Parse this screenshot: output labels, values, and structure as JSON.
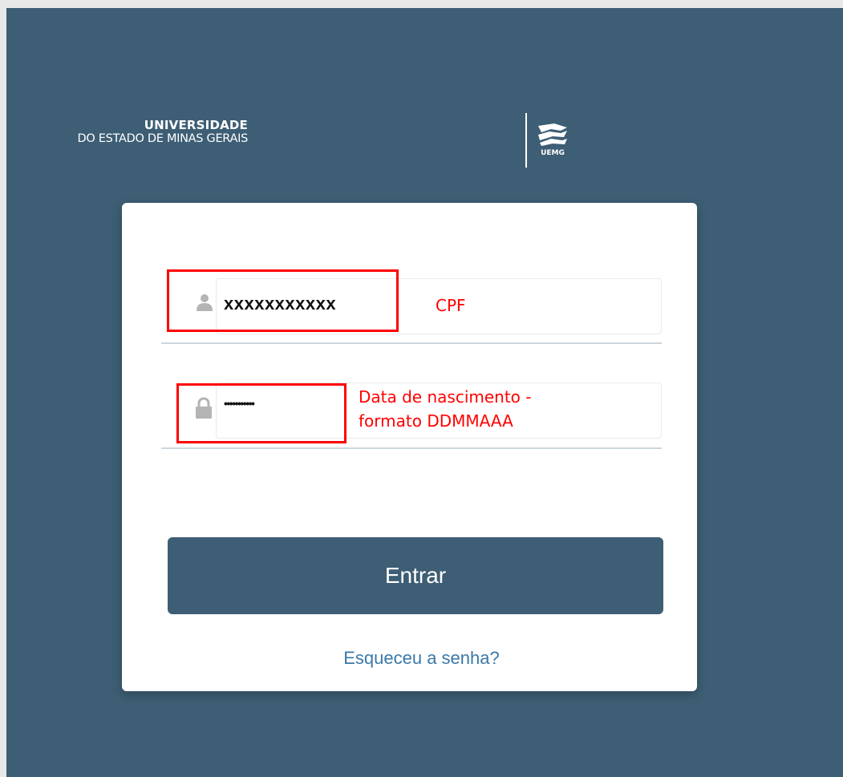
{
  "logo": {
    "line1": "UNIVERSIDADE",
    "line2": "DO ESTADO DE MINAS GERAIS",
    "mark_text": "UEMG"
  },
  "login": {
    "user_icon": "user-icon",
    "user_value": "xxxxxxxxxxx",
    "password_icon": "lock-icon",
    "password_value": "•••••••••••",
    "submit_label": "Entrar",
    "forgot_label": "Esqueceu a senha?"
  },
  "annotations": {
    "cpf_note": "CPF",
    "date_note": "Data de nascimento - formato DDMMAAA",
    "color": "#ff0000"
  },
  "colors": {
    "background": "#3d5e74",
    "card": "#ffffff",
    "button": "#3d5e74",
    "link": "#3a78a8"
  }
}
